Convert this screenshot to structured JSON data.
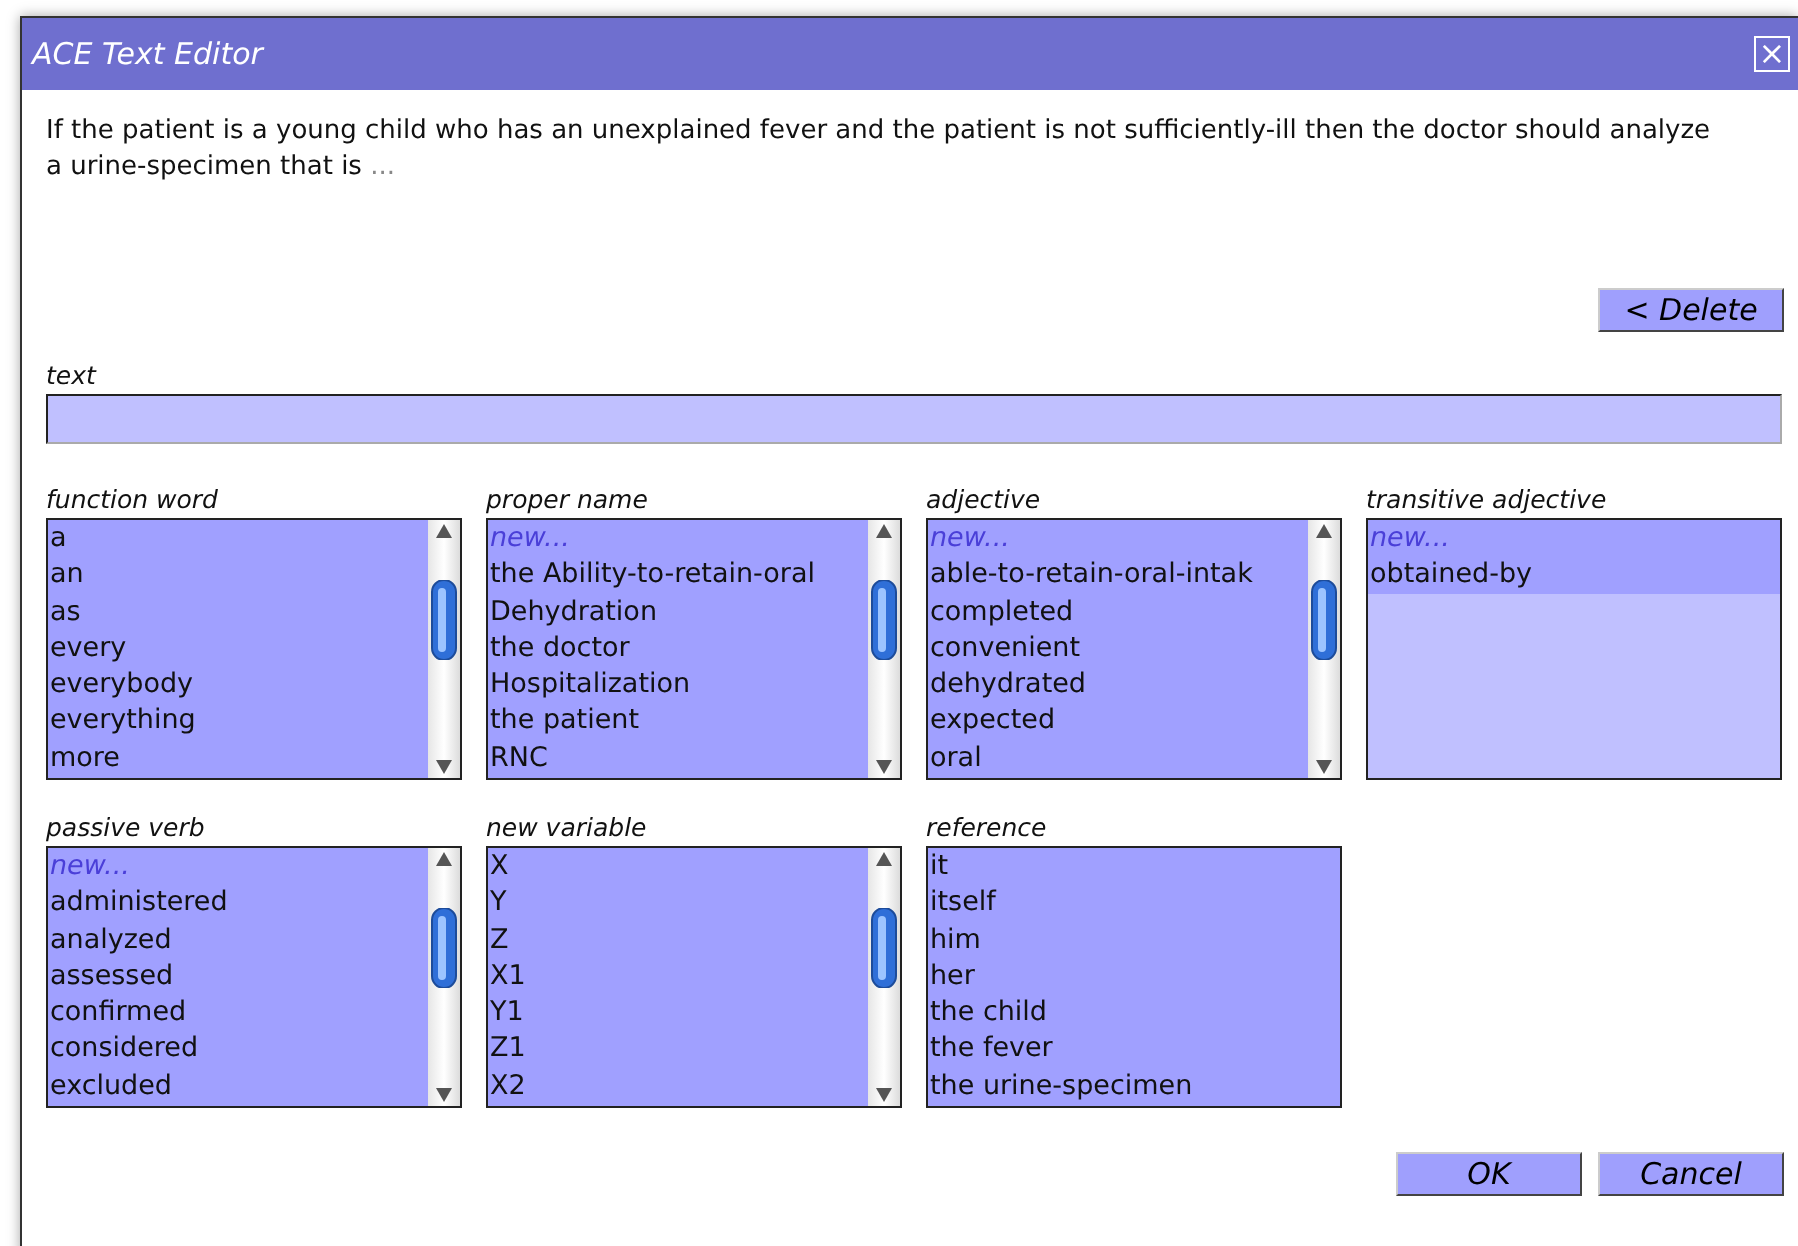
{
  "window": {
    "title": "ACE Text Editor",
    "close": "×"
  },
  "sentence": {
    "text": "If the patient is a young child who has an unexplained fever and the patient is not sufficiently-ill then the doctor should analyze a urine-specimen that is",
    "ellipsis": "..."
  },
  "delete_button": "< Delete",
  "text_field": {
    "label": "text"
  },
  "lists": [
    {
      "label": "function word",
      "scrollable": true,
      "items": [
        {
          "text": "a",
          "kind": "word"
        },
        {
          "text": "an",
          "kind": "word"
        },
        {
          "text": "as",
          "kind": "word"
        },
        {
          "text": "every",
          "kind": "word"
        },
        {
          "text": "everybody",
          "kind": "word"
        },
        {
          "text": "everything",
          "kind": "word"
        },
        {
          "text": "more",
          "kind": "word"
        }
      ]
    },
    {
      "label": "proper name",
      "scrollable": true,
      "items": [
        {
          "text": "new...",
          "kind": "new"
        },
        {
          "text": "the Ability-to-retain-oral",
          "kind": "word"
        },
        {
          "text": "Dehydration",
          "kind": "word"
        },
        {
          "text": "the doctor",
          "kind": "word"
        },
        {
          "text": "Hospitalization",
          "kind": "word"
        },
        {
          "text": "the patient",
          "kind": "word"
        },
        {
          "text": "RNC",
          "kind": "word"
        }
      ]
    },
    {
      "label": "adjective",
      "scrollable": true,
      "items": [
        {
          "text": "new...",
          "kind": "new"
        },
        {
          "text": "able-to-retain-oral-intak",
          "kind": "word"
        },
        {
          "text": "completed",
          "kind": "word"
        },
        {
          "text": "convenient",
          "kind": "word"
        },
        {
          "text": "dehydrated",
          "kind": "word"
        },
        {
          "text": "expected",
          "kind": "word"
        },
        {
          "text": "oral",
          "kind": "word"
        }
      ]
    },
    {
      "label": "transitive adjective",
      "scrollable": false,
      "items": [
        {
          "text": "new...",
          "kind": "new"
        },
        {
          "text": "obtained-by",
          "kind": "word"
        }
      ]
    },
    {
      "label": "passive verb",
      "scrollable": true,
      "items": [
        {
          "text": "new...",
          "kind": "new"
        },
        {
          "text": "administered",
          "kind": "word"
        },
        {
          "text": "analyzed",
          "kind": "word"
        },
        {
          "text": "assessed",
          "kind": "word"
        },
        {
          "text": "confirmed",
          "kind": "word"
        },
        {
          "text": "considered",
          "kind": "word"
        },
        {
          "text": "excluded",
          "kind": "word"
        }
      ]
    },
    {
      "label": "new variable",
      "scrollable": true,
      "items": [
        {
          "text": "X",
          "kind": "word"
        },
        {
          "text": "Y",
          "kind": "word"
        },
        {
          "text": "Z",
          "kind": "word"
        },
        {
          "text": "X1",
          "kind": "word"
        },
        {
          "text": "Y1",
          "kind": "word"
        },
        {
          "text": "Z1",
          "kind": "word"
        },
        {
          "text": "X2",
          "kind": "word"
        }
      ]
    },
    {
      "label": "reference",
      "scrollable": false,
      "items": [
        {
          "text": "it",
          "kind": "word"
        },
        {
          "text": "itself",
          "kind": "word"
        },
        {
          "text": "him",
          "kind": "word"
        },
        {
          "text": "her",
          "kind": "word"
        },
        {
          "text": "the child",
          "kind": "word"
        },
        {
          "text": "the fever",
          "kind": "word"
        },
        {
          "text": "the urine-specimen",
          "kind": "word"
        }
      ]
    }
  ],
  "buttons": [
    "OK",
    "Cancel"
  ]
}
